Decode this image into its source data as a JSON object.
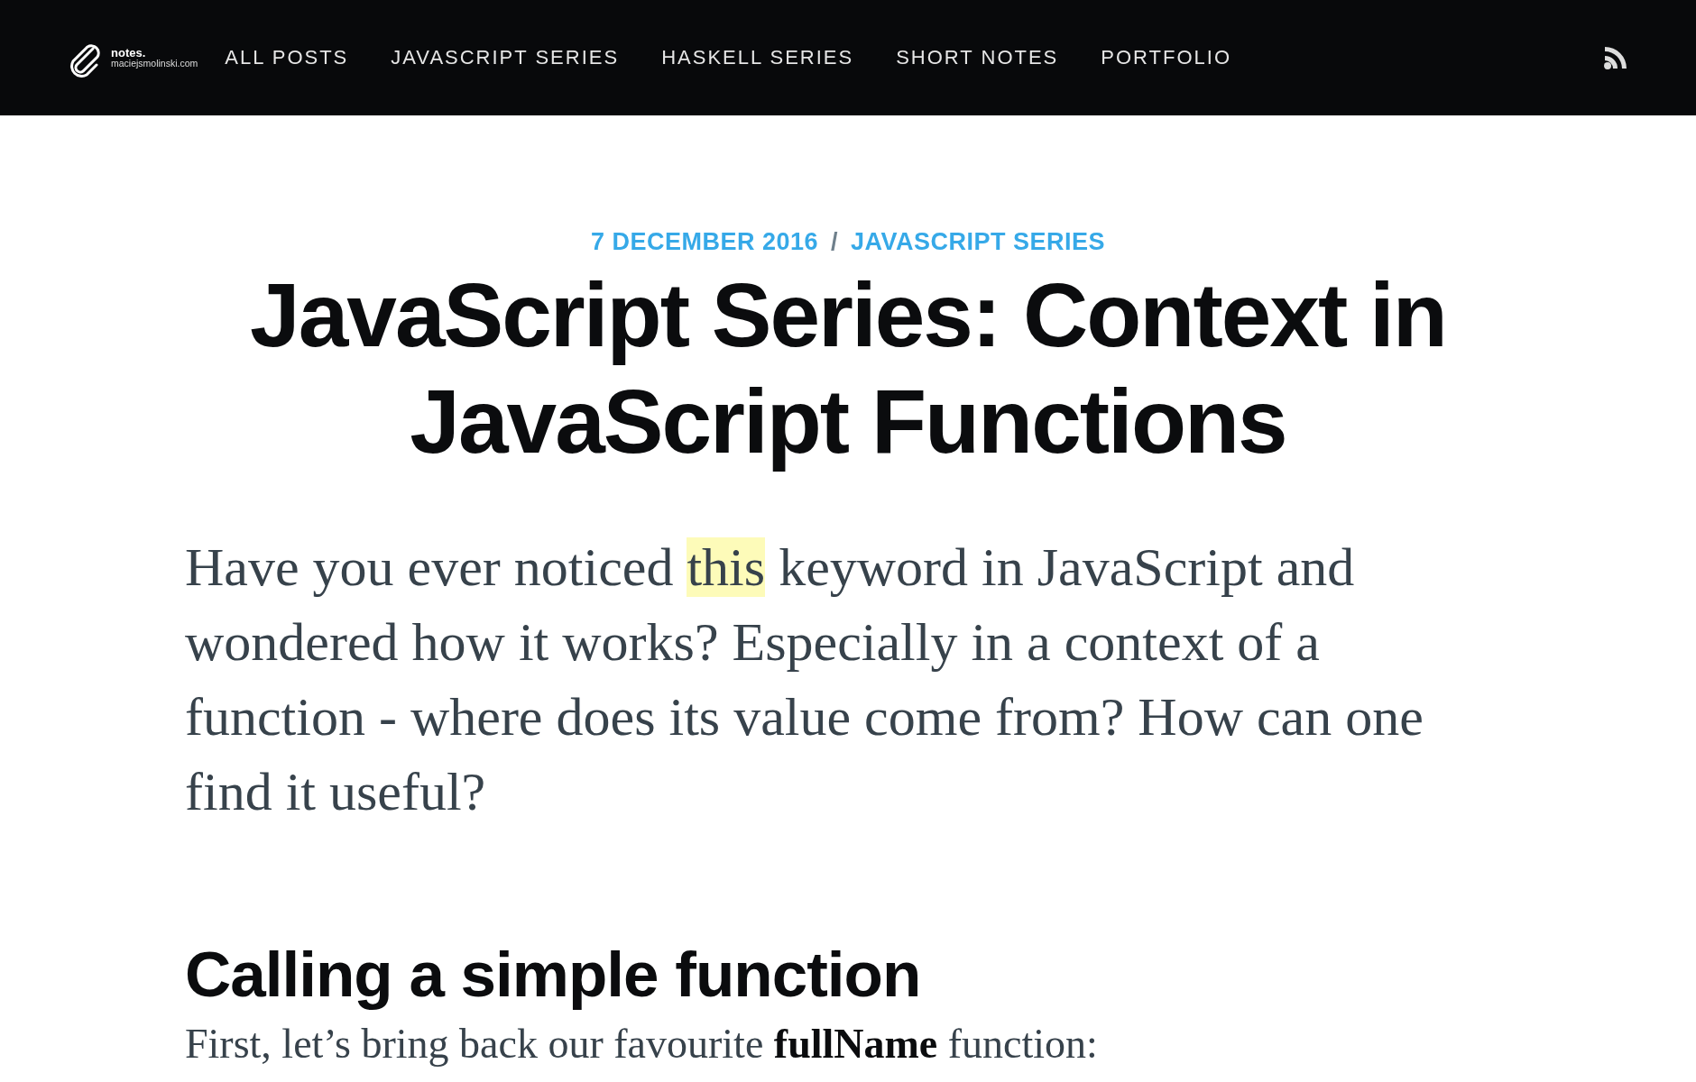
{
  "header": {
    "logo": {
      "title": "notes.",
      "subtitle": "maciejsmolinski.com"
    },
    "nav": [
      {
        "label": "ALL POSTS"
      },
      {
        "label": "JAVASCRIPT SERIES"
      },
      {
        "label": "HASKELL SERIES"
      },
      {
        "label": "SHORT NOTES"
      },
      {
        "label": "PORTFOLIO"
      }
    ]
  },
  "article": {
    "date": "7 DECEMBER 2016",
    "separator": "/",
    "category": "JAVASCRIPT SERIES",
    "title": "JavaScript Series: Context in JavaScript Functions",
    "intro": {
      "before": "Have you ever noticed ",
      "highlighted": "this",
      "after": " keyword in JavaScript and wondered how it works? Especially in a context of a function - where does its value come from? How can one find it useful?"
    },
    "heading": "Calling a simple function",
    "paragraph": "First, let’s bring back our favourite **fullName** function:"
  }
}
